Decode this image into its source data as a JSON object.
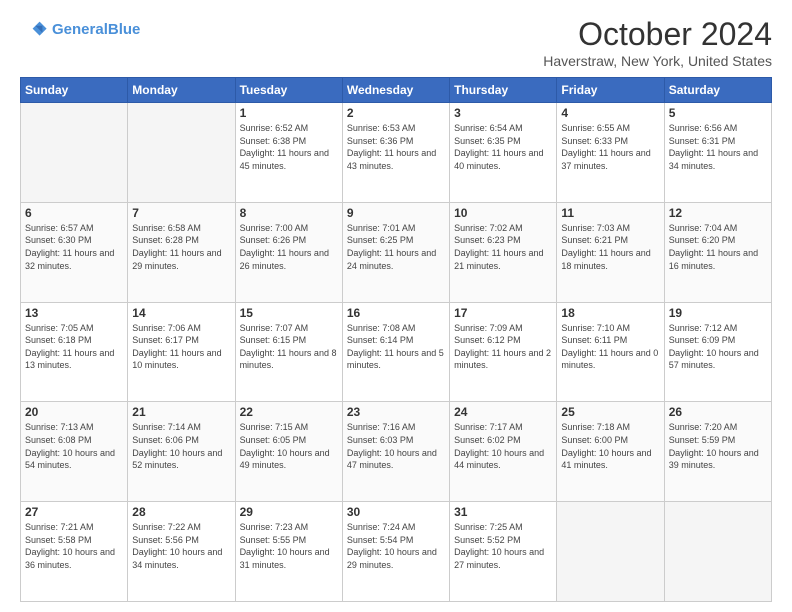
{
  "header": {
    "logo_line1": "General",
    "logo_line2": "Blue",
    "title": "October 2024",
    "subtitle": "Haverstraw, New York, United States"
  },
  "days_of_week": [
    "Sunday",
    "Monday",
    "Tuesday",
    "Wednesday",
    "Thursday",
    "Friday",
    "Saturday"
  ],
  "weeks": [
    [
      {
        "day": "",
        "empty": true
      },
      {
        "day": "",
        "empty": true
      },
      {
        "day": "1",
        "sunrise": "Sunrise: 6:52 AM",
        "sunset": "Sunset: 6:38 PM",
        "daylight": "Daylight: 11 hours and 45 minutes."
      },
      {
        "day": "2",
        "sunrise": "Sunrise: 6:53 AM",
        "sunset": "Sunset: 6:36 PM",
        "daylight": "Daylight: 11 hours and 43 minutes."
      },
      {
        "day": "3",
        "sunrise": "Sunrise: 6:54 AM",
        "sunset": "Sunset: 6:35 PM",
        "daylight": "Daylight: 11 hours and 40 minutes."
      },
      {
        "day": "4",
        "sunrise": "Sunrise: 6:55 AM",
        "sunset": "Sunset: 6:33 PM",
        "daylight": "Daylight: 11 hours and 37 minutes."
      },
      {
        "day": "5",
        "sunrise": "Sunrise: 6:56 AM",
        "sunset": "Sunset: 6:31 PM",
        "daylight": "Daylight: 11 hours and 34 minutes."
      }
    ],
    [
      {
        "day": "6",
        "sunrise": "Sunrise: 6:57 AM",
        "sunset": "Sunset: 6:30 PM",
        "daylight": "Daylight: 11 hours and 32 minutes."
      },
      {
        "day": "7",
        "sunrise": "Sunrise: 6:58 AM",
        "sunset": "Sunset: 6:28 PM",
        "daylight": "Daylight: 11 hours and 29 minutes."
      },
      {
        "day": "8",
        "sunrise": "Sunrise: 7:00 AM",
        "sunset": "Sunset: 6:26 PM",
        "daylight": "Daylight: 11 hours and 26 minutes."
      },
      {
        "day": "9",
        "sunrise": "Sunrise: 7:01 AM",
        "sunset": "Sunset: 6:25 PM",
        "daylight": "Daylight: 11 hours and 24 minutes."
      },
      {
        "day": "10",
        "sunrise": "Sunrise: 7:02 AM",
        "sunset": "Sunset: 6:23 PM",
        "daylight": "Daylight: 11 hours and 21 minutes."
      },
      {
        "day": "11",
        "sunrise": "Sunrise: 7:03 AM",
        "sunset": "Sunset: 6:21 PM",
        "daylight": "Daylight: 11 hours and 18 minutes."
      },
      {
        "day": "12",
        "sunrise": "Sunrise: 7:04 AM",
        "sunset": "Sunset: 6:20 PM",
        "daylight": "Daylight: 11 hours and 16 minutes."
      }
    ],
    [
      {
        "day": "13",
        "sunrise": "Sunrise: 7:05 AM",
        "sunset": "Sunset: 6:18 PM",
        "daylight": "Daylight: 11 hours and 13 minutes."
      },
      {
        "day": "14",
        "sunrise": "Sunrise: 7:06 AM",
        "sunset": "Sunset: 6:17 PM",
        "daylight": "Daylight: 11 hours and 10 minutes."
      },
      {
        "day": "15",
        "sunrise": "Sunrise: 7:07 AM",
        "sunset": "Sunset: 6:15 PM",
        "daylight": "Daylight: 11 hours and 8 minutes."
      },
      {
        "day": "16",
        "sunrise": "Sunrise: 7:08 AM",
        "sunset": "Sunset: 6:14 PM",
        "daylight": "Daylight: 11 hours and 5 minutes."
      },
      {
        "day": "17",
        "sunrise": "Sunrise: 7:09 AM",
        "sunset": "Sunset: 6:12 PM",
        "daylight": "Daylight: 11 hours and 2 minutes."
      },
      {
        "day": "18",
        "sunrise": "Sunrise: 7:10 AM",
        "sunset": "Sunset: 6:11 PM",
        "daylight": "Daylight: 11 hours and 0 minutes."
      },
      {
        "day": "19",
        "sunrise": "Sunrise: 7:12 AM",
        "sunset": "Sunset: 6:09 PM",
        "daylight": "Daylight: 10 hours and 57 minutes."
      }
    ],
    [
      {
        "day": "20",
        "sunrise": "Sunrise: 7:13 AM",
        "sunset": "Sunset: 6:08 PM",
        "daylight": "Daylight: 10 hours and 54 minutes."
      },
      {
        "day": "21",
        "sunrise": "Sunrise: 7:14 AM",
        "sunset": "Sunset: 6:06 PM",
        "daylight": "Daylight: 10 hours and 52 minutes."
      },
      {
        "day": "22",
        "sunrise": "Sunrise: 7:15 AM",
        "sunset": "Sunset: 6:05 PM",
        "daylight": "Daylight: 10 hours and 49 minutes."
      },
      {
        "day": "23",
        "sunrise": "Sunrise: 7:16 AM",
        "sunset": "Sunset: 6:03 PM",
        "daylight": "Daylight: 10 hours and 47 minutes."
      },
      {
        "day": "24",
        "sunrise": "Sunrise: 7:17 AM",
        "sunset": "Sunset: 6:02 PM",
        "daylight": "Daylight: 10 hours and 44 minutes."
      },
      {
        "day": "25",
        "sunrise": "Sunrise: 7:18 AM",
        "sunset": "Sunset: 6:00 PM",
        "daylight": "Daylight: 10 hours and 41 minutes."
      },
      {
        "day": "26",
        "sunrise": "Sunrise: 7:20 AM",
        "sunset": "Sunset: 5:59 PM",
        "daylight": "Daylight: 10 hours and 39 minutes."
      }
    ],
    [
      {
        "day": "27",
        "sunrise": "Sunrise: 7:21 AM",
        "sunset": "Sunset: 5:58 PM",
        "daylight": "Daylight: 10 hours and 36 minutes."
      },
      {
        "day": "28",
        "sunrise": "Sunrise: 7:22 AM",
        "sunset": "Sunset: 5:56 PM",
        "daylight": "Daylight: 10 hours and 34 minutes."
      },
      {
        "day": "29",
        "sunrise": "Sunrise: 7:23 AM",
        "sunset": "Sunset: 5:55 PM",
        "daylight": "Daylight: 10 hours and 31 minutes."
      },
      {
        "day": "30",
        "sunrise": "Sunrise: 7:24 AM",
        "sunset": "Sunset: 5:54 PM",
        "daylight": "Daylight: 10 hours and 29 minutes."
      },
      {
        "day": "31",
        "sunrise": "Sunrise: 7:25 AM",
        "sunset": "Sunset: 5:52 PM",
        "daylight": "Daylight: 10 hours and 27 minutes."
      },
      {
        "day": "",
        "empty": true
      },
      {
        "day": "",
        "empty": true
      }
    ]
  ]
}
